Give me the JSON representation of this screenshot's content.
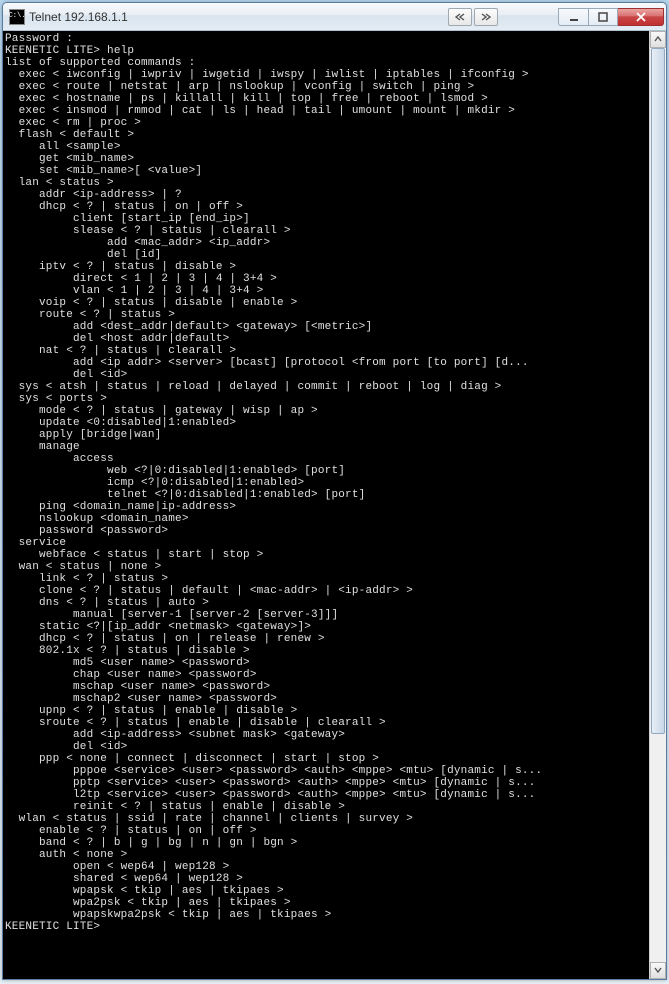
{
  "window": {
    "title_icon_text": "C:\\.",
    "title": "Telnet 192.168.1.1"
  },
  "terminal": {
    "lines": [
      "Password :",
      "KEENETIC LITE> help",
      "list of supported commands :",
      "  exec < iwconfig | iwpriv | iwgetid | iwspy | iwlist | iptables | ifconfig >",
      "  exec < route | netstat | arp | nslookup | vconfig | switch | ping >",
      "  exec < hostname | ps | killall | kill | top | free | reboot | lsmod >",
      "  exec < insmod | rmmod | cat | ls | head | tail | umount | mount | mkdir >",
      "  exec < rm | proc >",
      "  flash < default >",
      "     all <sample>",
      "     get <mib_name>",
      "     set <mib_name>[ <value>]",
      "  lan < status >",
      "     addr <ip-address> | ?",
      "     dhcp < ? | status | on | off >",
      "          client [start_ip [end_ip>]",
      "          slease < ? | status | clearall >",
      "               add <mac_addr> <ip_addr>",
      "               del [id]",
      "     iptv < ? | status | disable >",
      "          direct < 1 | 2 | 3 | 4 | 3+4 >",
      "          vlan < 1 | 2 | 3 | 4 | 3+4 >",
      "     voip < ? | status | disable | enable >",
      "     route < ? | status >",
      "          add <dest_addr|default> <gateway> [<metric>]",
      "          del <host addr|default>",
      "     nat < ? | status | clearall >",
      "          add <ip addr> <server> [bcast] [protocol <from port [to port] [d...",
      "          del <id>",
      "  sys < atsh | status | reload | delayed | commit | reboot | log | diag >",
      "  sys < ports >",
      "     mode < ? | status | gateway | wisp | ap >",
      "     update <0:disabled|1:enabled>",
      "     apply [bridge|wan]",
      "     manage",
      "          access",
      "               web <?|0:disabled|1:enabled> [port]",
      "               icmp <?|0:disabled|1:enabled>",
      "               telnet <?|0:disabled|1:enabled> [port]",
      "     ping <domain_name|ip-address>",
      "     nslookup <domain_name>",
      "     password <password>",
      "  service",
      "     webface < status | start | stop >",
      "  wan < status | none >",
      "     link < ? | status >",
      "     clone < ? | status | default | <mac-addr> | <ip-addr> >",
      "     dns < ? | status | auto >",
      "          manual [server-1 [server-2 [server-3]]]",
      "     static <?|[ip_addr <netmask> <gateway>]>",
      "     dhcp < ? | status | on | release | renew >",
      "     802.1x < ? | status | disable >",
      "          md5 <user name> <password>",
      "          chap <user name> <password>",
      "          mschap <user name> <password>",
      "          mschap2 <user name> <password>",
      "     upnp < ? | status | enable | disable >",
      "     sroute < ? | status | enable | disable | clearall >",
      "          add <ip-address> <subnet mask> <gateway>",
      "          del <id>",
      "     ppp < none | connect | disconnect | start | stop >",
      "          pppoe <service> <user> <password> <auth> <mppe> <mtu> [dynamic | s...",
      "          pptp <service> <user> <password> <auth> <mppe> <mtu> [dynamic | s...",
      "          l2tp <service> <user> <password> <auth> <mppe> <mtu> [dynamic | s...",
      "          reinit < ? | status | enable | disable >",
      "  wlan < status | ssid | rate | channel | clients | survey >",
      "     enable < ? | status | on | off >",
      "     band < ? | b | g | bg | n | gn | bgn >",
      "     auth < none >",
      "          open < wep64 | wep128 >",
      "          shared < wep64 | wep128 >",
      "          wpapsk < tkip | aes | tkipaes >",
      "          wpa2psk < tkip | aes | tkipaes >",
      "          wpapskwpa2psk < tkip | aes | tkipaes >",
      "KEENETIC LITE>"
    ]
  }
}
